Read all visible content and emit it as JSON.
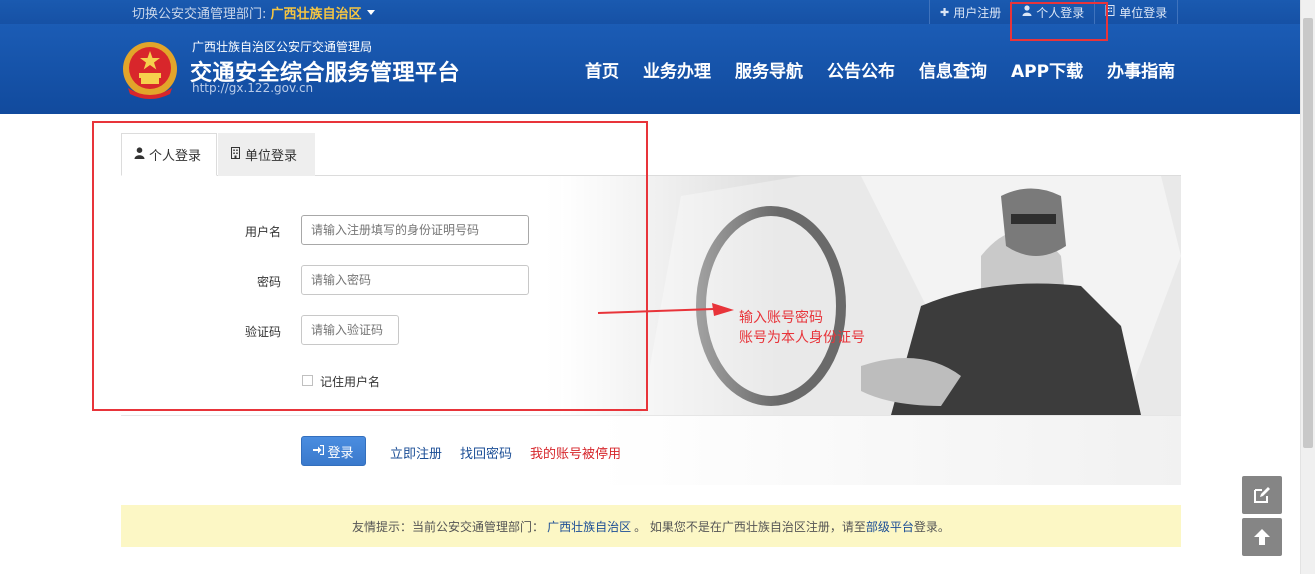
{
  "topbar": {
    "dept_prefix": "切换公安交通管理部门: ",
    "dept_name": "广西壮族自治区",
    "links": {
      "register": "用户注册",
      "personal_login": "个人登录",
      "unit_login": "单位登录"
    }
  },
  "header": {
    "subtitle": "广西壮族自治区公安厅交通管理局",
    "title": "交通安全综合服务管理平台",
    "url": "http://gx.122.gov.cn",
    "nav": {
      "home": "首页",
      "business": "业务办理",
      "service_nav": "服务导航",
      "notice": "公告公布",
      "info_query": "信息查询",
      "app": "APP下载",
      "guide": "办事指南"
    }
  },
  "tabs": {
    "personal": "个人登录",
    "unit": "单位登录"
  },
  "form": {
    "username_label": "用户名",
    "username_placeholder": "请输入注册填写的身份证明号码",
    "password_label": "密码",
    "password_placeholder": "请输入密码",
    "captcha_label": "验证码",
    "captcha_placeholder": "请输入验证码",
    "remember_label": "记住用户名"
  },
  "actions": {
    "login": "登录",
    "register_now": "立即注册",
    "recover_password": "找回密码",
    "account_disabled": "我的账号被停用"
  },
  "notice": {
    "prefix": "友情提示：当前公安交通管理部门：",
    "dept": "广西壮族自治区",
    "middle": "。 如果您不是在广西壮族自治区注册，请至",
    "link": "部级平台",
    "suffix": "登录。"
  },
  "annotation": {
    "line1": "输入账号密码",
    "line2": "账号为本人身份证号"
  },
  "colors": {
    "header_blue": "#1651a5",
    "dept_gold": "#f5c542",
    "annotation_red": "#e8343a",
    "notice_bg": "#fcf7c5",
    "link_blue": "#1b4e96",
    "link_red": "#d6262b"
  },
  "icons": {
    "register": "plus-icon",
    "personal": "user-icon",
    "unit": "building-icon",
    "login": "sign-in-icon",
    "edit": "edit-icon",
    "top": "arrow-up-icon"
  }
}
